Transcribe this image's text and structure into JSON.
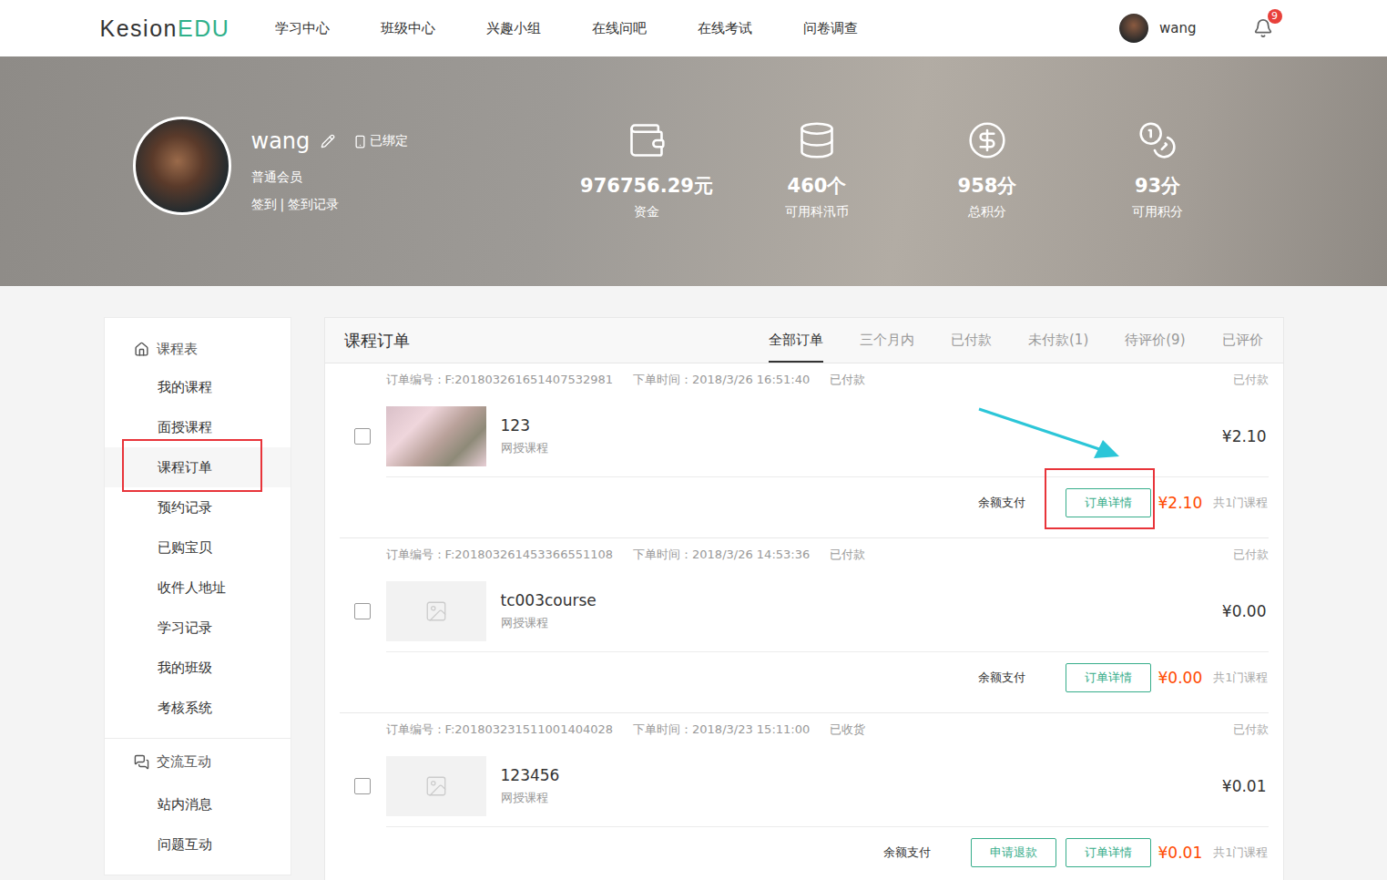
{
  "nav": {
    "logo": {
      "dark": "Kesion",
      "accent": "EDU"
    },
    "items": [
      "学习中心",
      "班级中心",
      "兴趣小组",
      "在线问吧",
      "在线考试",
      "问卷调查"
    ],
    "user": "wang",
    "notifications": "9"
  },
  "profile": {
    "name": "wang",
    "bound": "已绑定",
    "level": "普通会员",
    "sign_in": "签到",
    "separator": "|",
    "sign_in_log": "签到记录",
    "stats": [
      {
        "value": "976756.29元",
        "label": "资金"
      },
      {
        "value": "460个",
        "label": "可用科汛币"
      },
      {
        "value": "958分",
        "label": "总积分"
      },
      {
        "value": "93分",
        "label": "可用积分"
      }
    ]
  },
  "sidebar": {
    "sections": [
      {
        "title": "课程表",
        "items": [
          {
            "label": "我的课程",
            "selected": false
          },
          {
            "label": "面授课程",
            "selected": false
          },
          {
            "label": "课程订单",
            "selected": true
          },
          {
            "label": "预约记录",
            "selected": false
          },
          {
            "label": "已购宝贝",
            "selected": false
          },
          {
            "label": "收件人地址",
            "selected": false
          },
          {
            "label": "学习记录",
            "selected": false
          },
          {
            "label": "我的班级",
            "selected": false
          },
          {
            "label": "考核系统",
            "selected": false
          }
        ]
      },
      {
        "title": "交流互动",
        "items": [
          {
            "label": "站内消息",
            "selected": false
          },
          {
            "label": "问题互动",
            "selected": false
          }
        ]
      }
    ]
  },
  "panel": {
    "title": "课程订单",
    "tabs": [
      {
        "label": "全部订单",
        "selected": true
      },
      {
        "label": "三个月内",
        "selected": false
      },
      {
        "label": "已付款",
        "selected": false
      },
      {
        "label": "未付款(1)",
        "selected": false
      },
      {
        "label": "待评价(9)",
        "selected": false
      },
      {
        "label": "已评价",
        "selected": false
      }
    ]
  },
  "orders": [
    {
      "number": "订单编号：F:201803261651407532981",
      "time": "下单时间：2018/3/26 16:51:40",
      "status": "已付款",
      "right_status": "已付款",
      "checked": false,
      "thumbnail": "photo",
      "title": "123",
      "type": "网授课程",
      "price": "¥2.10",
      "payment": "余额支付",
      "buttons": [
        {
          "label": "订单详情",
          "highlighted": true
        }
      ],
      "total": "¥2.10",
      "count": "共1门课程"
    },
    {
      "number": "订单编号：F:201803261453366551108",
      "time": "下单时间：2018/3/26 14:53:36",
      "status": "已付款",
      "right_status": "已付款",
      "checked": false,
      "thumbnail": "placeholder",
      "title": "tc003course",
      "type": "网授课程",
      "price": "¥0.00",
      "payment": "余额支付",
      "buttons": [
        {
          "label": "订单详情",
          "highlighted": false
        }
      ],
      "total": "¥0.00",
      "count": "共1门课程"
    },
    {
      "number": "订单编号：F:201803231511001404028",
      "time": "下单时间：2018/3/23 15:11:00",
      "status": "已收货",
      "right_status": "已付款",
      "checked": false,
      "thumbnail": "placeholder",
      "title": "123456",
      "type": "网授课程",
      "price": "¥0.01",
      "payment": "余额支付",
      "buttons": [
        {
          "label": "申请退款",
          "highlighted": false
        },
        {
          "label": "订单详情",
          "highlighted": false
        }
      ],
      "total": "¥0.01",
      "count": "共1门课程"
    }
  ]
}
